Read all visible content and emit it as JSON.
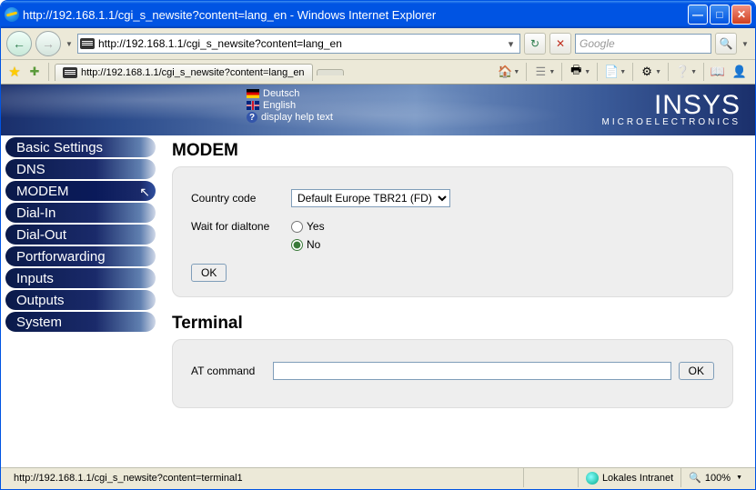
{
  "window": {
    "title": "http://192.168.1.1/cgi_s_newsite?content=lang_en - Windows Internet Explorer"
  },
  "address_bar": {
    "url": "http://192.168.1.1/cgi_s_newsite?content=lang_en"
  },
  "search": {
    "placeholder": "Google"
  },
  "tab": {
    "label": "http://192.168.1.1/cgi_s_newsite?content=lang_en"
  },
  "banner": {
    "lang_de": "Deutsch",
    "lang_en": "English",
    "help": "display help text",
    "logo_top": "INSYS",
    "logo_bottom": "MICROELECTRONICS"
  },
  "sidebar": {
    "items": [
      {
        "label": "Basic Settings"
      },
      {
        "label": "DNS"
      },
      {
        "label": "MODEM"
      },
      {
        "label": "Dial-In"
      },
      {
        "label": "Dial-Out"
      },
      {
        "label": "Portforwarding"
      },
      {
        "label": "Inputs"
      },
      {
        "label": "Outputs"
      },
      {
        "label": "System"
      }
    ]
  },
  "modem": {
    "title": "MODEM",
    "country_code_label": "Country code",
    "country_code_value": "Default Europe TBR21 (FD)",
    "wait_label": "Wait for dialtone",
    "yes": "Yes",
    "no": "No",
    "ok": "OK"
  },
  "terminal": {
    "title": "Terminal",
    "at_label": "AT command",
    "at_value": "",
    "ok": "OK"
  },
  "status": {
    "url": "http://192.168.1.1/cgi_s_newsite?content=terminal1",
    "zone": "Lokales Intranet",
    "zoom": "100%"
  }
}
